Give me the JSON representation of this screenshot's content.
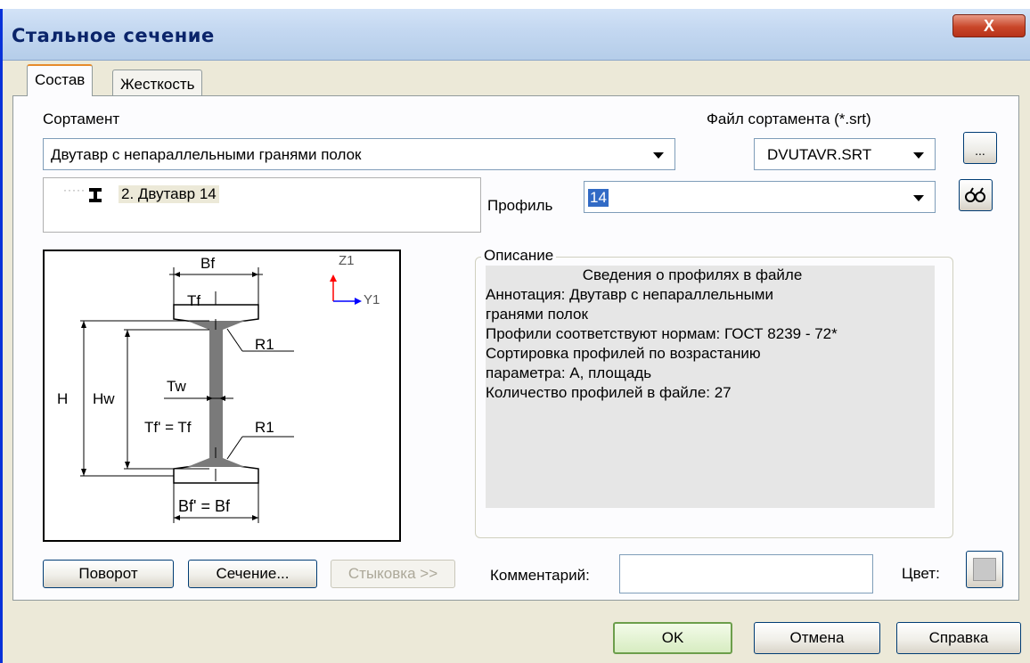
{
  "window": {
    "title": "Стальное сечение",
    "close_glyph": "X"
  },
  "tabs": [
    {
      "label": "Состав",
      "active": true
    },
    {
      "label": "Жесткость",
      "active": false
    }
  ],
  "sortament": {
    "label": "Сортамент",
    "value": "Двутавр с непараллельными гранями полок"
  },
  "file": {
    "label": "Файл сортамента (*.srt)",
    "value": "DVUTAVR.SRT",
    "browse_label": "..."
  },
  "tree": {
    "item_label": "2. Двутавр 14",
    "icon": "i-beam-icon"
  },
  "profile": {
    "label": "Профиль",
    "value": "14",
    "view_icon": "binoculars-icon"
  },
  "drawing": {
    "bf": "Bf",
    "tf": "Tf",
    "h": "H",
    "hw": "Hw",
    "tw": "Tw",
    "tf2": "Tf' = Tf",
    "r1_top": "R1",
    "r1_bottom": "R1",
    "bf2": "Bf' = Bf",
    "z_axis": "Z1",
    "y_axis": "Y1"
  },
  "description": {
    "label": "Описание",
    "lines": [
      "Сведения о профилях в файле",
      "Аннотация: Двутавр с непараллельными",
      "гранями полок",
      "Профили соответствуют нормам: ГОСТ 8239 - 72*",
      "Сортировка профилей по возрастанию",
      "параметра: А, площадь",
      "Количество профилей в файле: 27"
    ]
  },
  "buttons": {
    "rotate": "Поворот",
    "section": "Сечение...",
    "joint": "Стыковка >>",
    "ok": "OK",
    "cancel": "Отмена",
    "help": "Справка"
  },
  "comment": {
    "label": "Комментарий:",
    "value": ""
  },
  "color": {
    "label": "Цвет:",
    "swatch": "#c8c8c8"
  },
  "colors": {
    "title_text": "#0a246a",
    "close_button": "#c9472a",
    "axis_z": "#ff0000",
    "axis_y": "#0000ff"
  }
}
